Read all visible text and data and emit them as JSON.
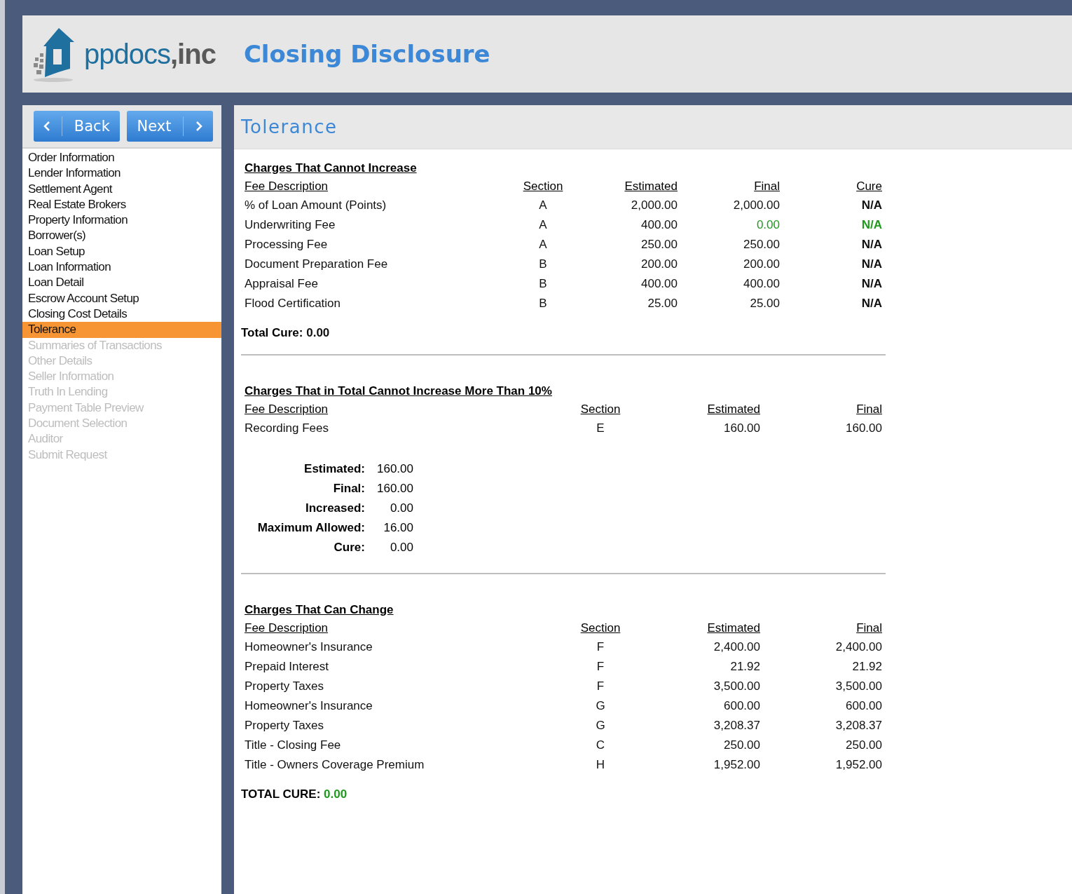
{
  "header": {
    "logo_name": "ppdocs",
    "logo_suffix": ",inc",
    "title": "Closing Disclosure"
  },
  "nav_buttons": [
    {
      "label": "Back",
      "kind": "back"
    },
    {
      "label": "Next",
      "kind": "next"
    }
  ],
  "sidebar": {
    "items": [
      {
        "label": "Order Information",
        "selected": false,
        "disabled": false
      },
      {
        "label": "Lender Information",
        "selected": false,
        "disabled": false
      },
      {
        "label": "Settlement Agent",
        "selected": false,
        "disabled": false
      },
      {
        "label": "Real Estate Brokers",
        "selected": false,
        "disabled": false
      },
      {
        "label": "Property Information",
        "selected": false,
        "disabled": false
      },
      {
        "label": "Borrower(s)",
        "selected": false,
        "disabled": false
      },
      {
        "label": "Loan Setup",
        "selected": false,
        "disabled": false
      },
      {
        "label": "Loan Information",
        "selected": false,
        "disabled": false
      },
      {
        "label": "Loan Detail",
        "selected": false,
        "disabled": false
      },
      {
        "label": "Escrow Account Setup",
        "selected": false,
        "disabled": false
      },
      {
        "label": "Closing Cost Details",
        "selected": false,
        "disabled": false
      },
      {
        "label": "Tolerance",
        "selected": true,
        "disabled": false
      },
      {
        "label": "Summaries of Transactions",
        "selected": false,
        "disabled": true
      },
      {
        "label": "Other Details",
        "selected": false,
        "disabled": true
      },
      {
        "label": "Seller Information",
        "selected": false,
        "disabled": true
      },
      {
        "label": "Truth In Lending",
        "selected": false,
        "disabled": true
      },
      {
        "label": "Payment Table Preview",
        "selected": false,
        "disabled": true
      },
      {
        "label": "Document Selection",
        "selected": false,
        "disabled": true
      },
      {
        "label": "Auditor",
        "selected": false,
        "disabled": true
      },
      {
        "label": "Submit Request",
        "selected": false,
        "disabled": true
      }
    ]
  },
  "content": {
    "title": "Tolerance",
    "sections": [
      {
        "heading": "Charges That Cannot Increase",
        "columns": [
          {
            "label": "Fee Description",
            "kind": "text"
          },
          {
            "label": "Section",
            "kind": "code"
          },
          {
            "label": "Estimated",
            "kind": "amount"
          },
          {
            "label": "Final",
            "kind": "final"
          },
          {
            "label": "Cure",
            "kind": "cure"
          }
        ],
        "rows": [
          {
            "cells": [
              "% of Loan Amount (Points)",
              "A",
              "2,000.00",
              "2,000.00",
              "N/A"
            ],
            "flagged": false
          },
          {
            "cells": [
              "Underwriting Fee",
              "A",
              "400.00",
              "0.00",
              "N/A"
            ],
            "flagged": true
          },
          {
            "cells": [
              "Processing Fee",
              "A",
              "250.00",
              "250.00",
              "N/A"
            ],
            "flagged": false
          },
          {
            "cells": [
              "Document Preparation Fee",
              "B",
              "200.00",
              "200.00",
              "N/A"
            ],
            "flagged": false
          },
          {
            "cells": [
              "Appraisal Fee",
              "B",
              "400.00",
              "400.00",
              "N/A"
            ],
            "flagged": false
          },
          {
            "cells": [
              "Flood Certification",
              "B",
              "25.00",
              "25.00",
              "N/A"
            ],
            "flagged": false
          }
        ],
        "total": {
          "label": "Total Cure:",
          "value": "0.00",
          "highlighted": false
        }
      },
      {
        "heading": "Charges That in Total Cannot Increase More Than 10%",
        "columns": [
          {
            "label": "Fee Description",
            "kind": "text"
          },
          {
            "label": "Section",
            "kind": "code"
          },
          {
            "label": "Estimated",
            "kind": "amount"
          },
          {
            "label": "Final",
            "kind": "final"
          }
        ],
        "rows": [
          {
            "cells": [
              "Recording Fees",
              "E",
              "160.00",
              "160.00"
            ],
            "flagged": false
          }
        ],
        "summary": [
          {
            "label": "Estimated:",
            "value": "160.00"
          },
          {
            "label": "Final:",
            "value": "160.00"
          },
          {
            "label": "Increased:",
            "value": "0.00"
          },
          {
            "label": "Maximum Allowed:",
            "value": "16.00"
          },
          {
            "label": "Cure:",
            "value": "0.00"
          }
        ]
      },
      {
        "heading": "Charges That Can Change",
        "columns": [
          {
            "label": "Fee Description",
            "kind": "text"
          },
          {
            "label": "Section",
            "kind": "code"
          },
          {
            "label": "Estimated",
            "kind": "amount"
          },
          {
            "label": "Final",
            "kind": "final"
          }
        ],
        "rows": [
          {
            "cells": [
              "Homeowner's Insurance",
              "F",
              "2,400.00",
              "2,400.00"
            ],
            "flagged": false
          },
          {
            "cells": [
              "Prepaid Interest",
              "F",
              "21.92",
              "21.92"
            ],
            "flagged": false
          },
          {
            "cells": [
              "Property Taxes",
              "F",
              "3,500.00",
              "3,500.00"
            ],
            "flagged": false
          },
          {
            "cells": [
              "Homeowner's Insurance",
              "G",
              "600.00",
              "600.00"
            ],
            "flagged": false
          },
          {
            "cells": [
              "Property Taxes",
              "G",
              "3,208.37",
              "3,208.37"
            ],
            "flagged": false
          },
          {
            "cells": [
              "Title - Closing Fee",
              "C",
              "250.00",
              "250.00"
            ],
            "flagged": false
          },
          {
            "cells": [
              "Title - Owners Coverage Premium",
              "H",
              "1,952.00",
              "1,952.00"
            ],
            "flagged": false
          }
        ],
        "total": {
          "label": "TOTAL CURE:",
          "value": "0.00",
          "highlighted": true
        }
      }
    ]
  }
}
